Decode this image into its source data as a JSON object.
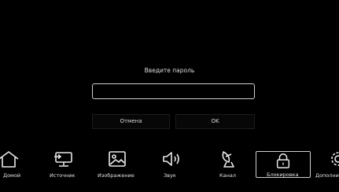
{
  "dialog": {
    "title": "Введите пароль",
    "password_value": "",
    "cancel_label": "Отмена",
    "ok_label": "OK"
  },
  "menu": {
    "items": [
      {
        "label": "Домой",
        "icon": "home-icon"
      },
      {
        "label": "Источник",
        "icon": "source-icon"
      },
      {
        "label": "Изображение",
        "icon": "picture-icon"
      },
      {
        "label": "Звук",
        "icon": "sound-icon"
      },
      {
        "label": "Канал",
        "icon": "channel-antenna-icon"
      },
      {
        "label": "Блокировка",
        "icon": "lock-icon",
        "selected": true
      },
      {
        "label": "Дополнительно",
        "icon": "gear-icon"
      }
    ]
  },
  "colors": {
    "background": "#000000",
    "text": "#e0e0e0",
    "border": "#d0d0d0"
  }
}
